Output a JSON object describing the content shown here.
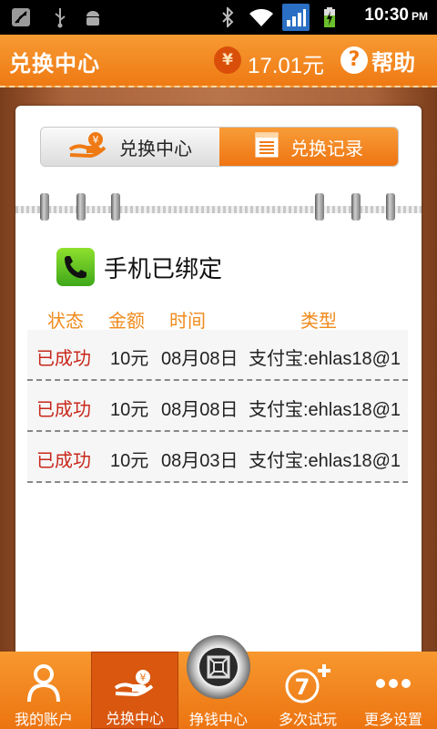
{
  "status_bar": {
    "time": "10:30",
    "ampm": "PM",
    "icons": [
      "satellite-icon",
      "usb-icon",
      "android-icon",
      "bluetooth-icon",
      "wifi-icon",
      "signal-icon",
      "battery-charging-icon"
    ]
  },
  "header": {
    "title": "兑换中心",
    "currency_symbol": "¥",
    "balance": "17.01元",
    "help_symbol": "?",
    "help_label": "帮助"
  },
  "tabs": [
    {
      "label": "兑换中心",
      "icon": "hand-yuan-icon",
      "active": false
    },
    {
      "label": "兑换记录",
      "icon": "notepad-icon",
      "active": true
    }
  ],
  "phone_status": {
    "label": "手机已绑定",
    "icon": "phone-icon"
  },
  "table": {
    "columns": [
      "状态",
      "金额",
      "时间",
      "类型"
    ],
    "rows": [
      {
        "status": "已成功",
        "amount": "10元",
        "date": "08月08日",
        "type": "支付宝:ehlas18@1"
      },
      {
        "status": "已成功",
        "amount": "10元",
        "date": "08月08日",
        "type": "支付宝:ehlas18@1"
      },
      {
        "status": "已成功",
        "amount": "10元",
        "date": "08月03日",
        "type": "支付宝:ehlas18@1"
      }
    ]
  },
  "bottom_nav": [
    {
      "label": "我的账户",
      "icon": "user-icon",
      "selected": false
    },
    {
      "label": "兑换中心",
      "icon": "hand-yuan-icon",
      "selected": true
    },
    {
      "label": "挣钱中心",
      "icon": "safe-icon",
      "selected": false
    },
    {
      "label": "多次试玩",
      "icon": "seven-plus-icon",
      "selected": false,
      "icon_text": "7"
    },
    {
      "label": "更多设置",
      "icon": "more-dots-icon",
      "selected": false
    }
  ],
  "colors": {
    "accent": "#ef7a14",
    "status_success": "#c8281c",
    "column_header": "#f08a1c"
  }
}
